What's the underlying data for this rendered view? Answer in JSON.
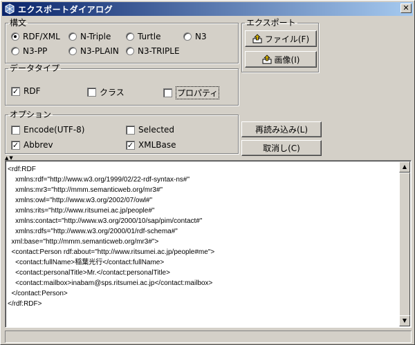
{
  "window": {
    "title": "エクスポートダイアログ",
    "close_label": "✕"
  },
  "syntax": {
    "legend": "構文",
    "options": [
      {
        "label": "RDF/XML",
        "selected": true
      },
      {
        "label": "N-Triple",
        "selected": false
      },
      {
        "label": "Turtle",
        "selected": false
      },
      {
        "label": "N3",
        "selected": false
      },
      {
        "label": "N3-PP",
        "selected": false
      },
      {
        "label": "N3-PLAIN",
        "selected": false
      },
      {
        "label": "N3-TRIPLE",
        "selected": false
      }
    ]
  },
  "datatype": {
    "legend": "データタイプ",
    "options": [
      {
        "label": "RDF",
        "checked": true
      },
      {
        "label": "クラス",
        "checked": false
      },
      {
        "label": "プロパティ",
        "checked": false
      }
    ]
  },
  "options": {
    "legend": "オプション",
    "items": [
      {
        "label": "Encode(UTF-8)",
        "checked": false
      },
      {
        "label": "Selected",
        "checked": false
      },
      {
        "label": "Abbrev",
        "checked": true
      },
      {
        "label": "XMLBase",
        "checked": true
      }
    ]
  },
  "export": {
    "legend": "エクスポート",
    "file_button": "ファイル(F)",
    "image_button": "画像(I)"
  },
  "reload_button": "再読み込み(L)",
  "cancel_button": "取消し(C)",
  "splitter_glyphs": "▲▼",
  "output_text": "<rdf:RDF\n    xmlns:rdf=\"http://www.w3.org/1999/02/22-rdf-syntax-ns#\"\n    xmlns:mr3=\"http://mmm.semanticweb.org/mr3#\"\n    xmlns:owl=\"http://www.w3.org/2002/07/owl#\"\n    xmlns:rits=\"http://www.ritsumei.ac.jp/people#\"\n    xmlns:contact=\"http://www.w3.org/2000/10/sap/pim/contact#\"\n    xmlns:rdfs=\"http://www.w3.org/2000/01/rdf-schema#\"\n  xml:base=\"http://mmm.semanticweb.org/mr3#\">\n  <contact:Person rdf:about=\"http://www.ritsumei.ac.jp/people#me\">\n    <contact:fullName>稲葉光行</contact:fullName>\n    <contact:personalTitle>Mr.</contact:personalTitle>\n    <contact:mailbox>inabam@sps.ritsumei.ac.jp</contact:mailbox>\n  </contact:Person>\n</rdf:RDF>",
  "colors": {
    "titlebar_start": "#0a246a",
    "titlebar_end": "#a6caf0",
    "face": "#d4d0c8"
  }
}
